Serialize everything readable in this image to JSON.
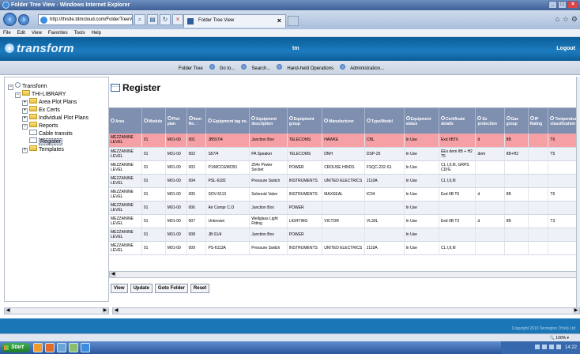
{
  "window": {
    "title": "Folder Tree View - Windows Internet Explorer"
  },
  "browser": {
    "address": "http://thistle.tdmcloud.com/FolderTreeV",
    "tab_label": "Folder Tree View",
    "menu": [
      "File",
      "Edit",
      "View",
      "Favorites",
      "Tools",
      "Help"
    ]
  },
  "header": {
    "logo": "transform",
    "center": "tm",
    "logout": "Logout"
  },
  "nav": [
    "Folder Tree",
    "Go to...",
    "Search...",
    "Hand-held Operations",
    "Administration..."
  ],
  "tree": [
    {
      "label": "Transform",
      "level": 0,
      "toggle": "−"
    },
    {
      "label": "THI-LIBRARY",
      "level": 1,
      "toggle": "−"
    },
    {
      "label": "Area Plot Plans",
      "level": 2,
      "toggle": "+"
    },
    {
      "label": "Ex Certs",
      "level": 2,
      "toggle": "+"
    },
    {
      "label": "Individual Plot Plans",
      "level": 2,
      "toggle": "+"
    },
    {
      "label": "Reports",
      "level": 2,
      "toggle": "−"
    },
    {
      "label": "Cable transits",
      "level": 3,
      "toggle": ""
    },
    {
      "label": "Register",
      "level": 3,
      "toggle": "",
      "selected": true
    },
    {
      "label": "Templates",
      "level": 2,
      "toggle": "+"
    }
  ],
  "register": {
    "title": "Register",
    "columns": [
      "Area",
      "Module",
      "Plot plan",
      "Item No. ↑",
      "Equipment tag no.",
      "Equipment description",
      "Equipment group",
      "Manufacturer",
      "Type/Model",
      "Equipment status",
      "Certificate details",
      "Ex protection",
      "Gas group",
      "IP Rating",
      "Temperature classification"
    ],
    "rows": [
      [
        "MEZZANINE LEVEL",
        "01",
        "M01-00",
        "001",
        "JB557/4",
        "Junction Box",
        "TELECOMS",
        "HAWKE",
        "CBL",
        "In Use",
        "Exd IIBT6",
        "d",
        "IIB",
        "",
        "T6"
      ],
      [
        "MEZZANINE LEVEL",
        "01",
        "M01-00",
        "002",
        "S57/4",
        "PA Speaker",
        "TELECOMS",
        "DNH",
        "DSP-25",
        "In Use",
        "EEx dem IIB + H2 T5",
        "dem",
        "IIB+H2",
        "",
        "T5"
      ],
      [
        "MEZZANINE LEVEL",
        "01",
        "M01-00",
        "003",
        "P1/MCC6/MCB1",
        "254v Power Socket",
        "POWER",
        "CROUSE HINDS",
        "FSQC-232-S1",
        "In Use",
        "CL I,II,III, GRPS CD/G",
        "",
        "",
        "",
        ""
      ],
      [
        "MEZZANINE LEVEL",
        "01",
        "M01-00",
        "004",
        "PSL-6182",
        "Pressure Switch",
        "INSTRUMENTS",
        "UNITED ELECTRICS",
        "J110A",
        "In Use",
        "CL I,II,III",
        "",
        "",
        "",
        ""
      ],
      [
        "MEZZANINE LEVEL",
        "01",
        "M01-00",
        "005",
        "SOV-6113",
        "Solenoid Valve",
        "INSTRUMENTS",
        "MAXSEAL",
        "IC04",
        "In Use",
        "Exd IIB T6",
        "d",
        "IIB",
        "",
        "T6"
      ],
      [
        "MEZZANINE LEVEL",
        "01",
        "M01-00",
        "006",
        "Air Compr C.O",
        "Junction Box",
        "POWER",
        "",
        "",
        "In Use",
        "",
        "",
        "",
        "",
        ""
      ],
      [
        "MEZZANINE LEVEL",
        "01",
        "M01-00",
        "007",
        "Unknown",
        "Wellglass Light Fitting",
        "LIGHTING",
        "VICTOR",
        "VL39L",
        "In Use",
        "Exd IIB T3",
        "d",
        "IIB",
        "",
        "T3"
      ],
      [
        "MEZZANINE LEVEL",
        "01",
        "M01-00",
        "008",
        "JB 01/4",
        "Junction Box",
        "POWER",
        "",
        "",
        "In Use",
        "",
        "",
        "",
        "",
        ""
      ],
      [
        "MEZZANINE LEVEL",
        "01",
        "M01-00",
        "009",
        "PS-6113A",
        "Pressure Switch",
        "INSTRUMENTS",
        "UNITED ELECTRICS",
        "J110A",
        "In Use",
        "CL I,II,III",
        "",
        "",
        "",
        ""
      ]
    ],
    "buttons": [
      "View",
      "Update",
      "Goto Folder",
      "Reset"
    ]
  },
  "footer": {
    "copyright": "Copyright 2010 Terrington (York) Ltd"
  },
  "status": {
    "zoom": "100%"
  },
  "taskbar": {
    "start": "Start",
    "clock": "14:22"
  }
}
